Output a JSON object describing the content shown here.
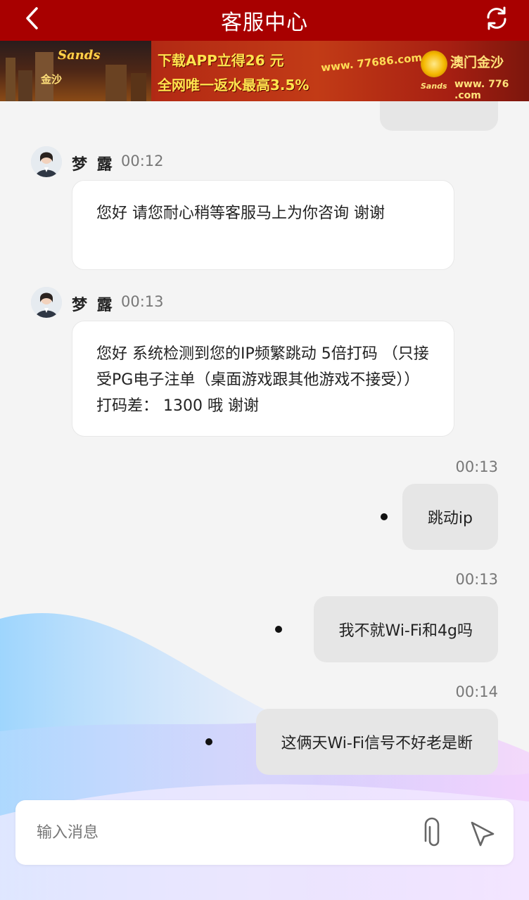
{
  "header": {
    "title": "客服中心",
    "back_icon": "chevron-left-icon",
    "refresh_icon": "refresh-icon"
  },
  "banner": {
    "sands_logo": "Sands",
    "sands_cn": "金沙",
    "promo_line1": "下载APP立得26 元",
    "promo_line2": "全网唯一返水最高3.5%",
    "url_left": "www. 77686.com",
    "brand_right": "澳门金沙",
    "brand_small": "Sands",
    "url_right": "www. 776 .com"
  },
  "messages": [
    {
      "sender": "梦 露",
      "time": "00:12",
      "text": "您好 请您耐心稍等客服马上为你咨询 谢谢"
    },
    {
      "sender": "梦 露",
      "time": "00:13",
      "text": "您好 系统检测到您的IP频繁跳动 5倍打码 （只接受PG电子注单（桌面游戏跟其他游戏不接受））打码差： 1300 哦 谢谢"
    },
    {
      "time": "00:13",
      "text": "跳动ip"
    },
    {
      "time": "00:13",
      "text": "我不就Wi-Fi和4g吗"
    },
    {
      "time": "00:14",
      "text": "这俩天Wi-Fi信号不好老是断"
    }
  ],
  "input": {
    "placeholder": "输入消息",
    "value": "",
    "attach_icon": "paperclip-icon",
    "send_icon": "send-icon"
  },
  "colors": {
    "header_bg": "#a80000",
    "user_bubble": "#e6e6e6",
    "agent_bubble": "#ffffff"
  }
}
